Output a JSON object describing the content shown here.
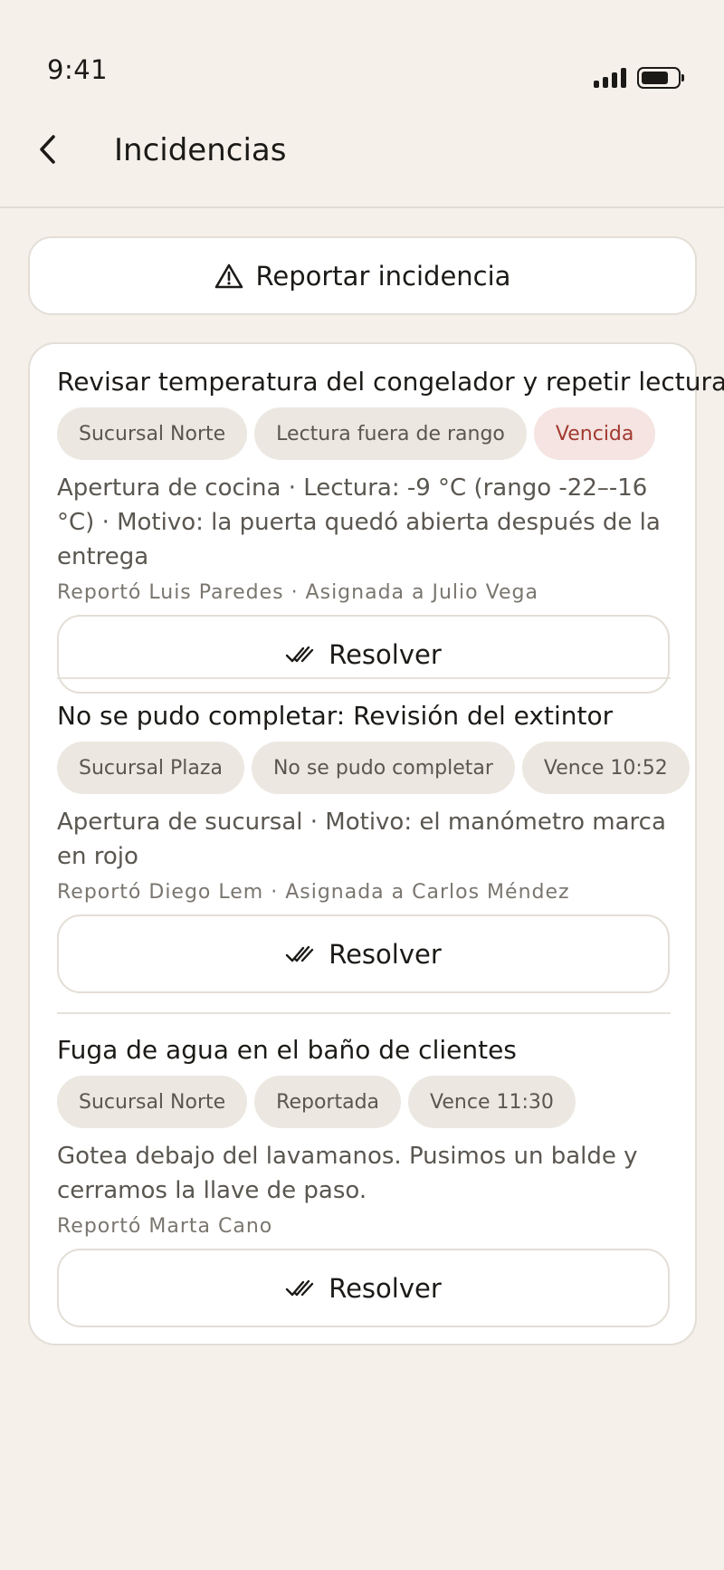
{
  "status_bar": {
    "time": "9:41"
  },
  "header": {
    "title": "Incidencias",
    "back_icon": "chevron-left-icon"
  },
  "report_button": {
    "label": "Reportar incidencia",
    "icon": "warning-triangle-icon"
  },
  "colors": {
    "background": "#f5f1ea",
    "tag_bg": "#ece8e1",
    "overdue_text": "#a13a30",
    "overdue_bg": "#f5e4e1"
  },
  "incidents": [
    {
      "title": "Revisar temperatura del congelador y repetir lectura",
      "tags": [
        "Sucursal Norte",
        "Lectura fuera de rango",
        "Vencida"
      ],
      "description": "Apertura de cocina · Lectura: -9 °C (rango -22–-16 °C) · Motivo: la puerta quedó abierta después de la entrega",
      "meta": "Reportó Luis Paredes · Asignada a Julio Vega",
      "action_label": "Resolver"
    },
    {
      "title": "No se pudo completar: Revisión del extintor",
      "tags": [
        "Sucursal Plaza",
        "No se pudo completar",
        "Vence 10:52"
      ],
      "description": "Apertura de sucursal · Motivo: el manómetro marca en rojo",
      "meta": "Reportó Diego Lem · Asignada a Carlos Méndez",
      "action_label": "Resolver"
    },
    {
      "title": "Fuga de agua en el baño de clientes",
      "tags": [
        "Sucursal Norte",
        "Reportada",
        "Vence 11:30"
      ],
      "description": "Gotea debajo del lavamanos. Pusimos un balde y cerramos la llave de paso.",
      "meta": "Reportó Marta Cano",
      "action_label": "Resolver"
    }
  ]
}
